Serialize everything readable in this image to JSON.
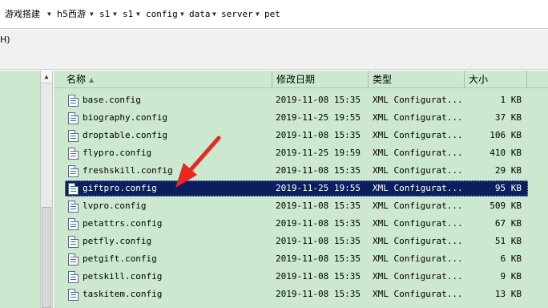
{
  "breadcrumb": [
    "游戏搭建",
    "h5西游",
    "s1",
    "s1",
    "config",
    "data",
    "server",
    "pet"
  ],
  "menu_fragment": "H)",
  "columns": {
    "name": "名称",
    "date": "修改日期",
    "type": "类型",
    "size": "大小"
  },
  "files": [
    {
      "name": "base.config",
      "date": "2019-11-08 15:35",
      "type": "XML Configurat...",
      "size": "1 KB"
    },
    {
      "name": "biography.config",
      "date": "2019-11-25 19:55",
      "type": "XML Configurat...",
      "size": "37 KB"
    },
    {
      "name": "droptable.config",
      "date": "2019-11-08 15:35",
      "type": "XML Configurat...",
      "size": "106 KB"
    },
    {
      "name": "flypro.config",
      "date": "2019-11-25 19:59",
      "type": "XML Configurat...",
      "size": "410 KB"
    },
    {
      "name": "freshskill.config",
      "date": "2019-11-08 15:35",
      "type": "XML Configurat...",
      "size": "29 KB"
    },
    {
      "name": "giftpro.config",
      "date": "2019-11-25 19:55",
      "type": "XML Configurat...",
      "size": "95 KB",
      "selected": true
    },
    {
      "name": "lvpro.config",
      "date": "2019-11-08 15:35",
      "type": "XML Configurat...",
      "size": "509 KB"
    },
    {
      "name": "petattrs.config",
      "date": "2019-11-08 15:35",
      "type": "XML Configurat...",
      "size": "67 KB"
    },
    {
      "name": "petfly.config",
      "date": "2019-11-08 15:35",
      "type": "XML Configurat...",
      "size": "51 KB"
    },
    {
      "name": "petgift.config",
      "date": "2019-11-08 15:35",
      "type": "XML Configurat...",
      "size": "6 KB"
    },
    {
      "name": "petskill.config",
      "date": "2019-11-08 15:35",
      "type": "XML Configurat...",
      "size": "9 KB"
    },
    {
      "name": "taskitem.config",
      "date": "2019-11-08 15:35",
      "type": "XML Configurat...",
      "size": "13 KB"
    }
  ],
  "colors": {
    "list_bg": "#cce8cf",
    "selection_bg": "#0b1f5e",
    "annotation_arrow": "#e8281e"
  },
  "icons": {
    "file": "xml-config-file-icon",
    "sort": "sort-ascending-icon",
    "separator": "breadcrumb-separator-icon"
  }
}
